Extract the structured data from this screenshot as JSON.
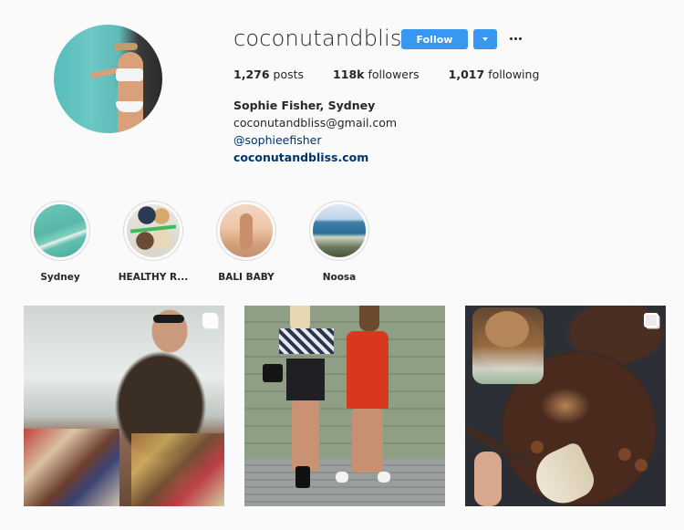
{
  "profile": {
    "username": "coconutandbliss",
    "follow_label": "Follow",
    "dropdown_icon": "caret-down-icon",
    "more_icon": "ellipsis-icon",
    "avatar_alt": "profile-picture",
    "stats": {
      "posts_count": "1,276",
      "posts_label": "posts",
      "followers_count": "118k",
      "followers_label": "followers",
      "following_count": "1,017",
      "following_label": "following"
    },
    "bio": {
      "name": "Sophie Fisher, Sydney",
      "email": "coconutandbliss@gmail.com",
      "mention": "@sophieefisher",
      "website": "coconutandbliss.com"
    }
  },
  "highlights": [
    {
      "label": "Sydney"
    },
    {
      "label": "HEALTHY R..."
    },
    {
      "label": "BALI BABY"
    },
    {
      "label": "Noosa"
    }
  ],
  "posts": [
    {
      "description": "woman with sunglasses at grazing platters",
      "multi_icon": "carousel-icon"
    },
    {
      "description": "two women standing against green wall",
      "multi_icon": null
    },
    {
      "description": "chocolate smoothie bowl with banana and hazelnuts",
      "multi_icon": "carousel-icon"
    }
  ],
  "colors": {
    "accent": "#3897f0",
    "background": "#fafafa",
    "text": "#262626",
    "link": "#003569"
  }
}
